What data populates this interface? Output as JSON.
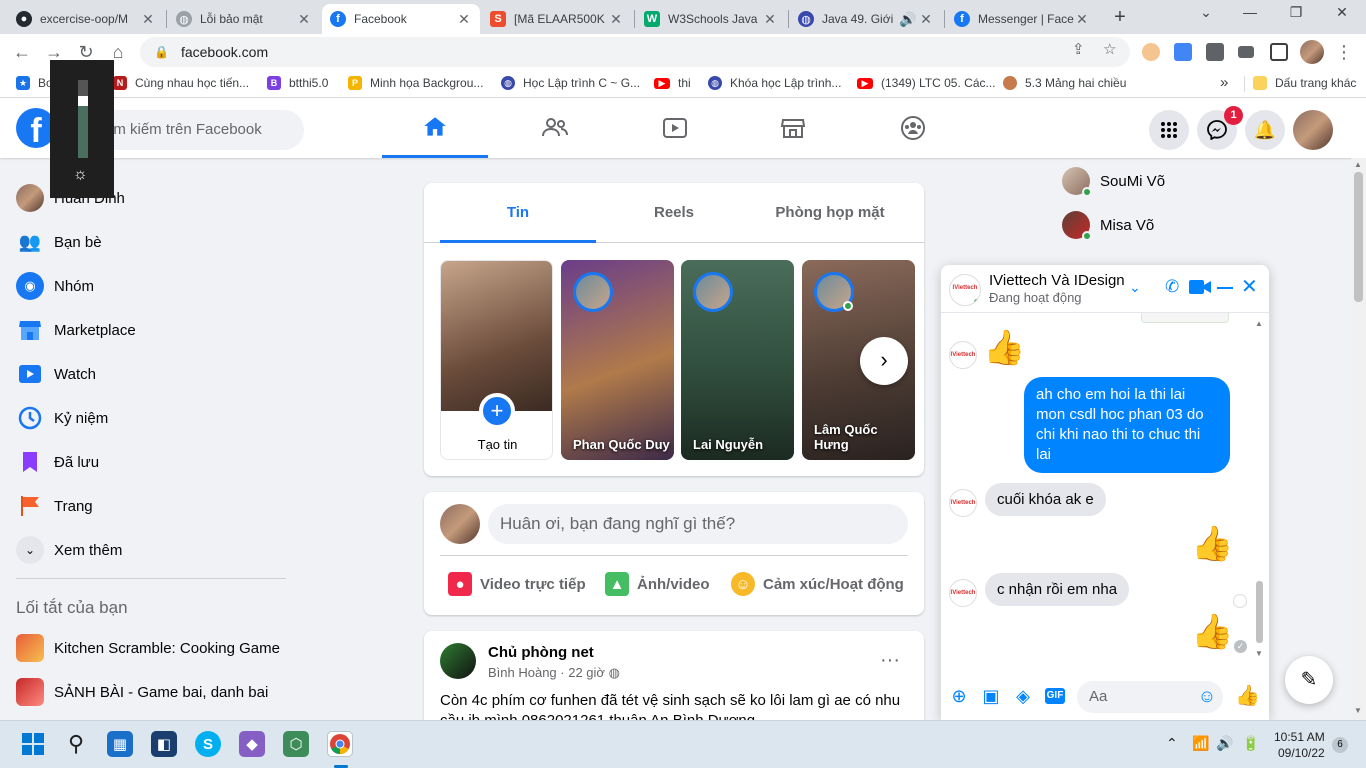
{
  "browser": {
    "tabs": [
      {
        "title": "excercise-oop/M",
        "icon": "github-icon",
        "color": "#24292f"
      },
      {
        "title": "Lỗi bảo mật",
        "icon": "globe-icon",
        "color": "#5f6368"
      },
      {
        "title": "Facebook",
        "icon": "facebook-icon",
        "color": "#1877f2",
        "active": true
      },
      {
        "title": "[Mã ELAAR500K",
        "icon": "shopee-icon",
        "color": "#ee4d2d"
      },
      {
        "title": "W3Schools Java",
        "icon": "w3schools-icon",
        "color": "#04aa6d"
      },
      {
        "title": "Java 49. Giới",
        "icon": "java-icon",
        "color": "#3949ab"
      },
      {
        "title": "Messenger | Face",
        "icon": "facebook-icon",
        "color": "#1877f2"
      }
    ],
    "url": "facebook.com",
    "bookmarks": [
      {
        "label": "Bo",
        "icon": "star-icon",
        "color": "#1a73e8"
      },
      {
        "label": "Cùng nhau học tiến...",
        "icon": "link-icon",
        "color": "#b71c1c"
      },
      {
        "label": "btthi5.0",
        "icon": "b-icon",
        "color": "#7b3fe4"
      },
      {
        "label": "Minh họa Backgrou...",
        "icon": "p-icon",
        "color": "#f5b400"
      },
      {
        "label": "Học Lập trình C ~ G...",
        "icon": "globe-icon",
        "color": "#3949ab"
      },
      {
        "label": "thi",
        "icon": "youtube-icon",
        "color": "#ff0000"
      },
      {
        "label": "Khóa học Lập trình...",
        "icon": "globe-icon",
        "color": "#3949ab"
      },
      {
        "label": "(1349) LTC 05. Các...",
        "icon": "youtube-icon",
        "color": "#ff0000"
      },
      {
        "label": "5.3 Mảng hai chiều",
        "icon": "avatar-icon",
        "color": "#c77b4a"
      }
    ],
    "bookmarks_more": "»",
    "bookmark_folder": "Dấu trang khác"
  },
  "facebook": {
    "logo": "f",
    "search_placeholder": "Tìm kiếm trên Facebook",
    "notification_count": "1",
    "sidebar": {
      "profile_name": "Huân Đinh",
      "items": [
        {
          "label": "Bạn bè",
          "icon": "friends-icon",
          "color": "#1877f2"
        },
        {
          "label": "Nhóm",
          "icon": "groups-icon",
          "color": "#1877f2"
        },
        {
          "label": "Marketplace",
          "icon": "marketplace-icon",
          "color": "#1877f2"
        },
        {
          "label": "Watch",
          "icon": "watch-icon",
          "color": "#1877f2"
        },
        {
          "label": "Kỷ niệm",
          "icon": "memories-icon",
          "color": "#1877f2"
        },
        {
          "label": "Đã lưu",
          "icon": "saved-icon",
          "color": "#8b3dff"
        },
        {
          "label": "Trang",
          "icon": "pages-icon",
          "color": "#f7612c"
        },
        {
          "label": "Xem thêm",
          "icon": "chevron-down-icon",
          "color": "#050505"
        }
      ],
      "shortcuts_heading": "Lối tắt của bạn",
      "shortcuts": [
        {
          "label": "Kitchen Scramble: Cooking Game"
        },
        {
          "label": "SẢNH BÀI - Game bai, danh bai"
        }
      ]
    },
    "stories": {
      "tabs": [
        "Tin",
        "Reels",
        "Phòng họp mặt"
      ],
      "create_label": "Tạo tin",
      "items": [
        {
          "name": "Phan Quốc Duy",
          "color": "#5b3a7a"
        },
        {
          "name": "Lai Nguyễn",
          "color": "#3b6d55"
        },
        {
          "name": "Lâm Quốc Hưng",
          "color": "#7a5a4a"
        }
      ]
    },
    "composer": {
      "placeholder": "Huân ơi, bạn đang nghĩ gì thế?",
      "actions": [
        {
          "label": "Video trực tiếp",
          "icon": "live-video-icon",
          "color": "#f02849"
        },
        {
          "label": "Ảnh/video",
          "icon": "photo-icon",
          "color": "#45bd62"
        },
        {
          "label": "Cảm xúc/Hoạt động",
          "icon": "feeling-icon",
          "color": "#f7b928"
        }
      ]
    },
    "post": {
      "title": "Chủ phòng net",
      "author": "Bình Hoàng",
      "time": "22 giờ",
      "text": "Còn 4c phím cơ funhen đã tét vệ sinh sạch sẽ ko lôi lam gì ae có nhu cầu ib mình 0862021261 thuận An Bình Dương"
    },
    "contacts": [
      {
        "name": "SouMi Võ"
      },
      {
        "name": "Misa Võ"
      }
    ],
    "chat": {
      "name": "IViettech Và IDesign",
      "status": "Đang hoạt động",
      "messages": [
        {
          "from": "them",
          "type": "like"
        },
        {
          "from": "me",
          "text": "ah cho em hoi la thi lai mon csdl hoc phan 03 do chi khi nao thi to chuc thi lai"
        },
        {
          "from": "them",
          "text": "cuối khóa ak e"
        },
        {
          "from": "me",
          "type": "like"
        },
        {
          "from": "them",
          "text": "c nhận rồi em nha"
        },
        {
          "from": "me",
          "type": "like"
        }
      ],
      "input_placeholder": "Aa"
    }
  },
  "taskbar": {
    "time": "10:51 AM",
    "date": "09/10/22",
    "notification_count": "6"
  }
}
